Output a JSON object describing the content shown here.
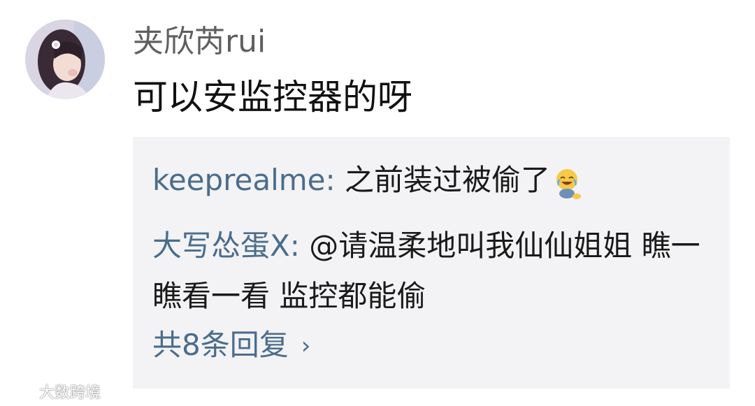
{
  "comment": {
    "username": "夹欣芮rui",
    "text": "可以安监控器的呀"
  },
  "replies": [
    {
      "author": "keeprealme:",
      "text": " 之前装过被偷了",
      "emoji": "laughing-crying-emoji"
    },
    {
      "author": "大写怂蛋X:",
      "text": " @请温柔地叫我仙仙姐姐 瞧一瞧看一看 监控都能偷"
    }
  ],
  "more_replies": {
    "label": "共8条回复",
    "icon": "chevron-right-icon"
  },
  "watermark": {
    "text": "大数跨境"
  }
}
